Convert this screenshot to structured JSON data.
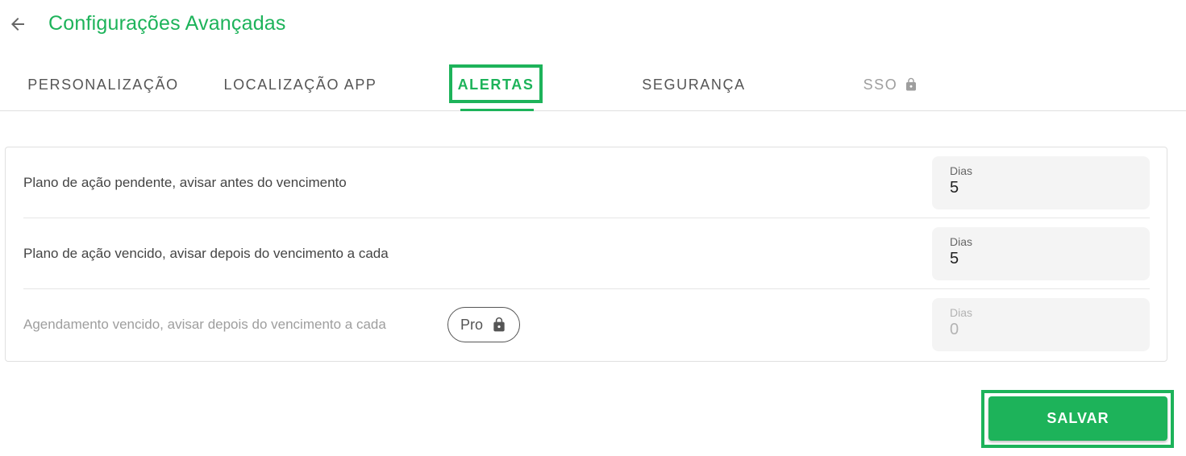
{
  "header": {
    "title": "Configurações Avançadas",
    "back_icon": "arrow-left-icon"
  },
  "tabs": [
    {
      "label": "PERSONALIZAÇÃO",
      "state": "normal"
    },
    {
      "label": "LOCALIZAÇÃO APP",
      "state": "normal"
    },
    {
      "label": "ALERTAS",
      "state": "active"
    },
    {
      "label": "SEGURANÇA",
      "state": "normal"
    },
    {
      "label": "SSO",
      "state": "locked",
      "icon": "lock-icon"
    }
  ],
  "alerts": [
    {
      "label": "Plano de ação pendente, avisar antes do vencimento",
      "field_label": "Dias",
      "value": "5",
      "enabled": true
    },
    {
      "label": "Plano de ação vencido, avisar depois do vencimento a cada",
      "field_label": "Dias",
      "value": "5",
      "enabled": true
    },
    {
      "label": "Agendamento vencido, avisar depois do vencimento a cada",
      "field_label": "Dias",
      "value": "0",
      "enabled": false,
      "badge": "Pro",
      "badge_icon": "lock-icon"
    }
  ],
  "actions": {
    "save_label": "SALVAR"
  },
  "colors": {
    "accent": "#1db35a",
    "text": "#444444",
    "muted": "#9e9e9e",
    "field_bg": "#f4f4f4"
  }
}
